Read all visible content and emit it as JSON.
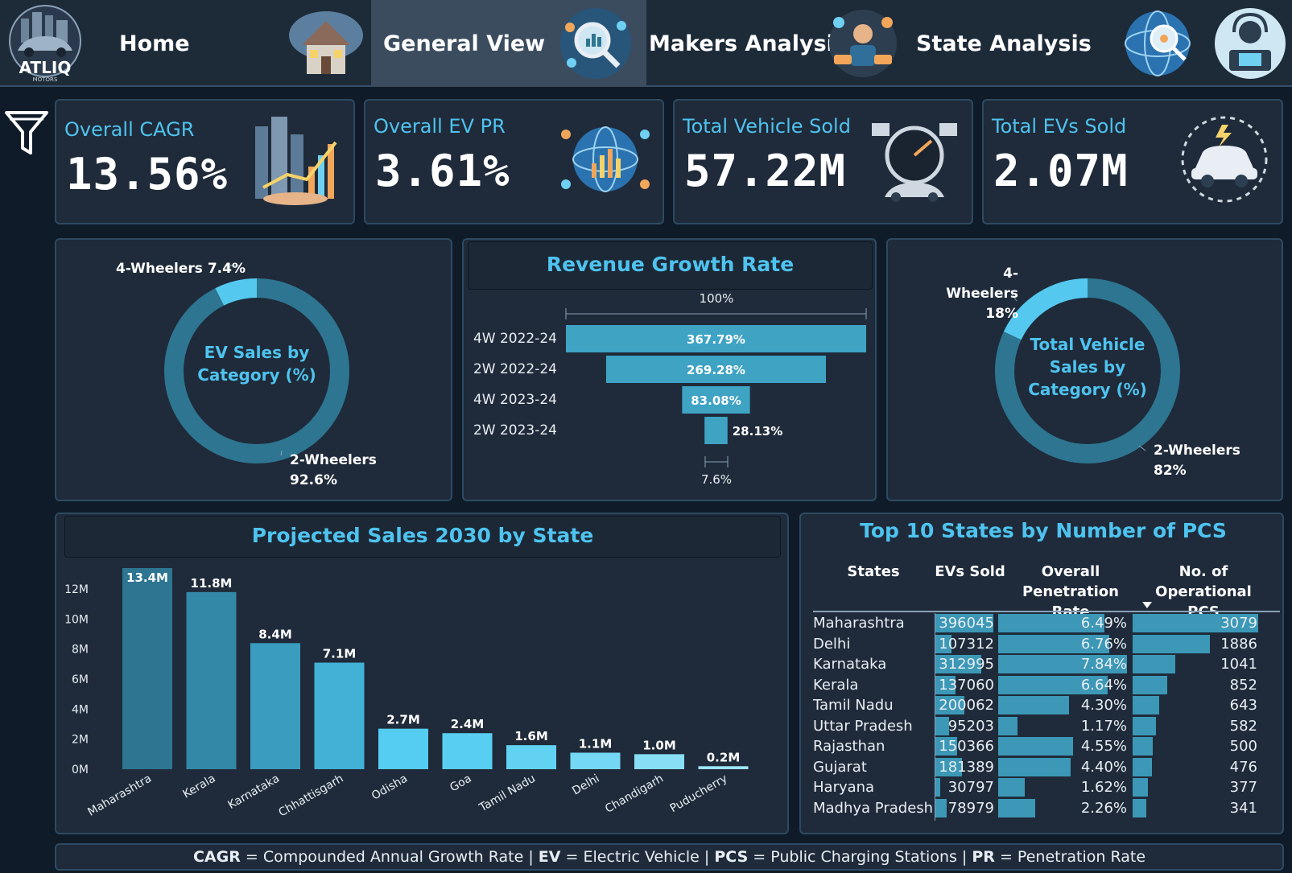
{
  "nav": {
    "logo_text": "ATLIQ",
    "logo_sub": "MOTORS",
    "items": [
      {
        "label": "Home"
      },
      {
        "label": "General View"
      },
      {
        "label": "Makers Analysis"
      },
      {
        "label": "State Analysis"
      }
    ]
  },
  "kpis": [
    {
      "title": "Overall CAGR",
      "value": "13.56%"
    },
    {
      "title": "Overall EV PR",
      "value": "3.61%"
    },
    {
      "title": "Total Vehicle Sold",
      "value": "57.22M"
    },
    {
      "title": "Total EVs Sold",
      "value": "2.07M"
    }
  ],
  "colors": {
    "accent": "#4ec3ef",
    "bar": "#3c98b6",
    "donut_main": "#2d7591",
    "donut_small": "#55c8ef"
  },
  "chart_data": [
    {
      "type": "pie",
      "title": "EV Sales by Category (%)",
      "labels": [
        "2-Wheelers",
        "4-Wheelers"
      ],
      "values": [
        92.6,
        7.4
      ],
      "display": [
        "92.6%",
        "7.4%"
      ]
    },
    {
      "type": "bar",
      "subtype": "funnel",
      "title": "Revenue Growth Rate",
      "categories": [
        "4W 2022-24",
        "2W 2022-24",
        "4W 2023-24",
        "2W 2023-24"
      ],
      "values": [
        367.79,
        269.28,
        83.08,
        28.13
      ],
      "display": [
        "367.79%",
        "269.28%",
        "83.08%",
        "28.13%"
      ],
      "top_label": "100%",
      "bottom_label": "7.6%"
    },
    {
      "type": "pie",
      "title": "Total Vehicle Sales by Category (%)",
      "labels": [
        "2-Wheelers",
        "4-Wheelers"
      ],
      "values": [
        82,
        18
      ],
      "display": [
        "82%",
        "18%"
      ]
    },
    {
      "type": "bar",
      "title": "Projected Sales 2030 by State",
      "categories": [
        "Maharashtra",
        "Kerala",
        "Karnataka",
        "Chhattisgarh",
        "Odisha",
        "Goa",
        "Tamil Nadu",
        "Delhi",
        "Chandigarh",
        "Puducherry"
      ],
      "values": [
        13.4,
        11.8,
        8.4,
        7.1,
        2.7,
        2.4,
        1.6,
        1.1,
        1.0,
        0.2
      ],
      "display": [
        "13.4M",
        "11.8M",
        "8.4M",
        "7.1M",
        "2.7M",
        "2.4M",
        "1.6M",
        "1.1M",
        "1.0M",
        "0.2M"
      ],
      "yticks": [
        "0M",
        "2M",
        "4M",
        "6M",
        "8M",
        "10M",
        "12M"
      ],
      "ylim": [
        0,
        13.4
      ]
    },
    {
      "type": "table",
      "title": "Top 10 States by Number of PCS",
      "columns": [
        "States",
        "EVs Sold",
        "Overall Penetration Rate",
        "No. of Operational PCS"
      ],
      "rows": [
        {
          "state": "Maharashtra",
          "evs": 396045,
          "pr": 6.49,
          "pr_label": "6.49%",
          "pcs": 3079
        },
        {
          "state": "Delhi",
          "evs": 107312,
          "pr": 6.76,
          "pr_label": "6.76%",
          "pcs": 1886
        },
        {
          "state": "Karnataka",
          "evs": 312995,
          "pr": 7.84,
          "pr_label": "7.84%",
          "pcs": 1041
        },
        {
          "state": "Kerala",
          "evs": 137060,
          "pr": 6.64,
          "pr_label": "6.64%",
          "pcs": 852
        },
        {
          "state": "Tamil Nadu",
          "evs": 200062,
          "pr": 4.3,
          "pr_label": "4.30%",
          "pcs": 643
        },
        {
          "state": "Uttar Pradesh",
          "evs": 95203,
          "pr": 1.17,
          "pr_label": "1.17%",
          "pcs": 582
        },
        {
          "state": "Rajasthan",
          "evs": 150366,
          "pr": 4.55,
          "pr_label": "4.55%",
          "pcs": 500
        },
        {
          "state": "Gujarat",
          "evs": 181389,
          "pr": 4.4,
          "pr_label": "4.40%",
          "pcs": 476
        },
        {
          "state": "Haryana",
          "evs": 30797,
          "pr": 1.62,
          "pr_label": "1.62%",
          "pcs": 377
        },
        {
          "state": "Madhya Pradesh",
          "evs": 78979,
          "pr": 2.26,
          "pr_label": "2.26%",
          "pcs": 341
        }
      ]
    }
  ],
  "footer": {
    "parts": [
      {
        "bold": "CAGR",
        "text": " = Compounded Annual Growth Rate | "
      },
      {
        "bold": "EV",
        "text": " = Electric Vehicle | "
      },
      {
        "bold": "PCS",
        "text": " = Public Charging Stations | "
      },
      {
        "bold": "PR",
        "text": " = Penetration Rate"
      }
    ]
  }
}
